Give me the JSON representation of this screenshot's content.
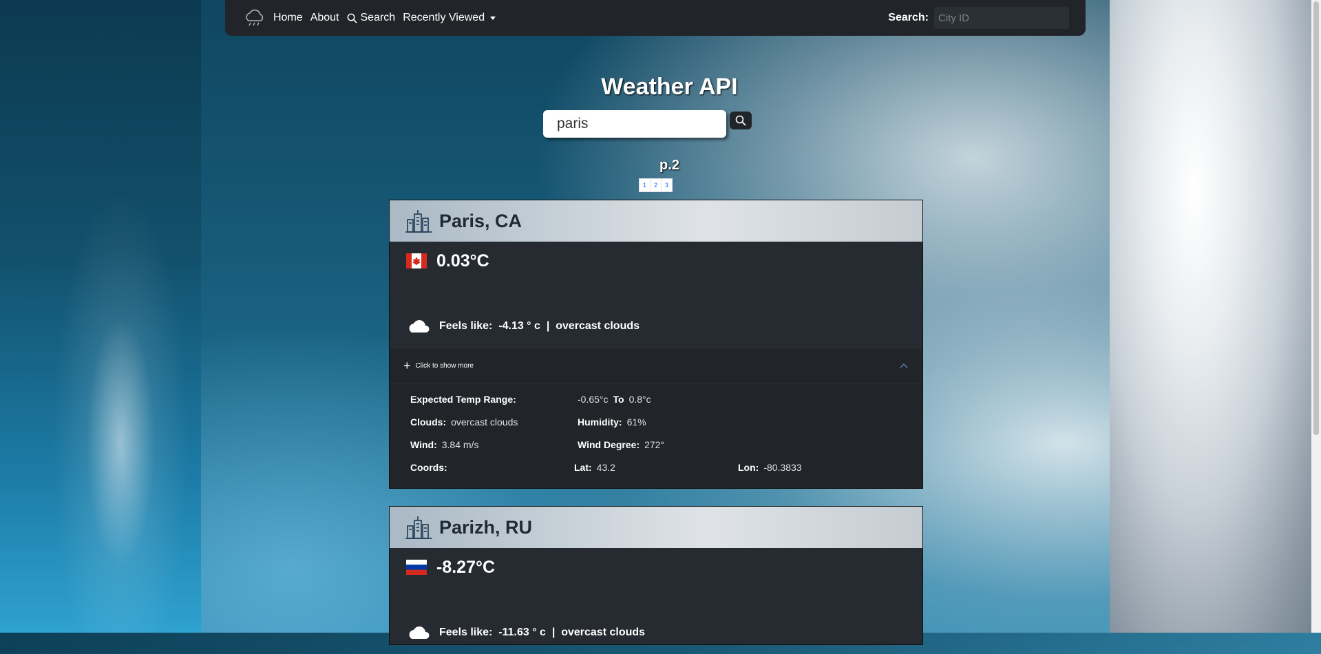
{
  "nav": {
    "home": "Home",
    "about": "About",
    "search": "Search",
    "recently_viewed": "Recently Viewed",
    "search_label": "Search:",
    "search_placeholder": "City ID"
  },
  "page": {
    "title": "Weather API",
    "search_value": "paris",
    "page_indicator": "p.2",
    "pages": [
      "1",
      "2",
      "3"
    ]
  },
  "cards": [
    {
      "city": "Paris, CA",
      "flag": "canada-flag",
      "temp": "0.03°C",
      "feels_label": "Feels like:",
      "feels_value": "-4.13 ° c",
      "separator": "|",
      "description": "overcast clouds",
      "more_label": "Click to show more",
      "details": {
        "temp_range_label": "Expected Temp Range:",
        "temp_min": "-0.65°c",
        "to_label": "To",
        "temp_max": "0.8°c",
        "clouds_label": "Clouds:",
        "clouds_value": "overcast clouds",
        "humidity_label": "Humidity:",
        "humidity_value": "61%",
        "wind_label": "Wind:",
        "wind_value": "3.84 m/s",
        "wind_degree_label": "Wind Degree:",
        "wind_degree_value": "272°",
        "coords_label": "Coords:",
        "lat_label": "Lat:",
        "lat_value": "43.2",
        "lon_label": "Lon:",
        "lon_value": "-80.3833"
      }
    },
    {
      "city": "Parizh, RU",
      "flag": "russia-flag",
      "temp": "-8.27°C",
      "feels_label": "Feels like:",
      "feels_value": "-11.63 ° c",
      "separator": "|",
      "description": "overcast clouds"
    }
  ],
  "colors": {
    "navbar": "#212529",
    "card_body": "#262a31",
    "link_blue": "#0d6efd"
  }
}
